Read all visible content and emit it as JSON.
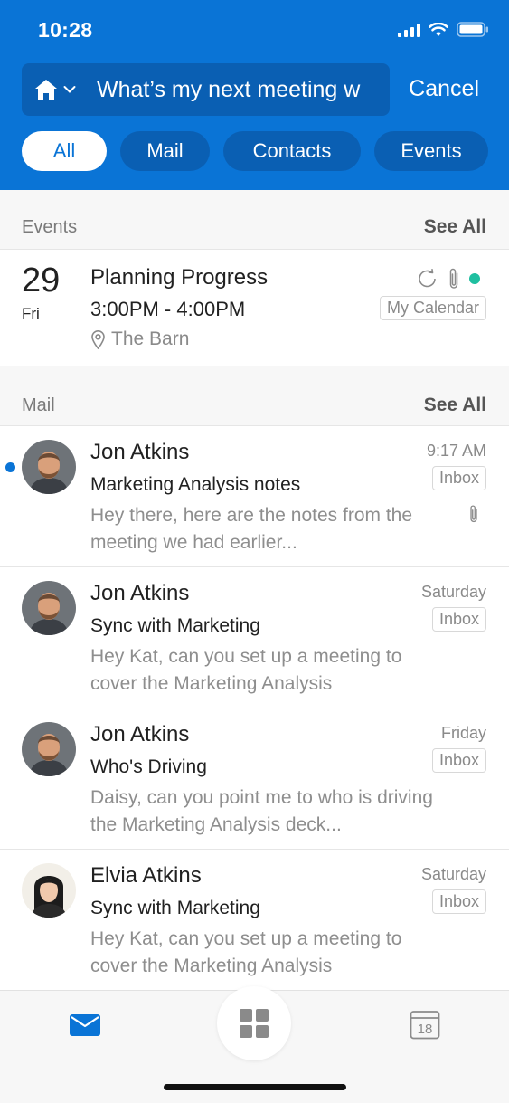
{
  "status": {
    "time": "10:28"
  },
  "search": {
    "query": "What’s my next meeting w",
    "cancel_label": "Cancel"
  },
  "filters": [
    {
      "label": "All",
      "active": true
    },
    {
      "label": "Mail",
      "active": false
    },
    {
      "label": "Contacts",
      "active": false
    },
    {
      "label": "Events",
      "active": false
    }
  ],
  "events_section": {
    "title": "Events",
    "see_all": "See All",
    "item": {
      "day_number": "29",
      "day_name": "Fri",
      "title": "Planning Progress",
      "time": "3:00PM - 4:00PM",
      "location": "The Barn",
      "calendar": "My Calendar"
    }
  },
  "mail_section": {
    "title": "Mail",
    "see_all": "See All",
    "items": [
      {
        "sender": "Jon Atkins",
        "subject": "Marketing Analysis notes",
        "preview": "Hey there, here are the notes from the meeting we had earlier...",
        "time": "9:17 AM",
        "folder": "Inbox",
        "unread": true,
        "attachment": true
      },
      {
        "sender": "Jon Atkins",
        "subject": "Sync with Marketing",
        "preview": "Hey Kat, can you set up a meeting to cover the Marketing Analysis",
        "time": "Saturday",
        "folder": "Inbox",
        "unread": false,
        "attachment": false
      },
      {
        "sender": "Jon Atkins",
        "subject": "Who's Driving",
        "preview": "Daisy, can you point me to who is driving the Marketing Analysis deck...",
        "time": "Friday",
        "folder": "Inbox",
        "unread": false,
        "attachment": false
      },
      {
        "sender": "Elvia Atkins",
        "subject": "Sync with Marketing",
        "preview": "Hey Kat, can you set up a meeting to cover the Marketing Analysis",
        "time": "Saturday",
        "folder": "Inbox",
        "unread": false,
        "attachment": false
      }
    ]
  },
  "tabbar": {
    "calendar_day": "18"
  },
  "colors": {
    "brand": "#0a74d6",
    "brand_dark": "#0a5fb3",
    "status_green": "#1fbfa0"
  }
}
